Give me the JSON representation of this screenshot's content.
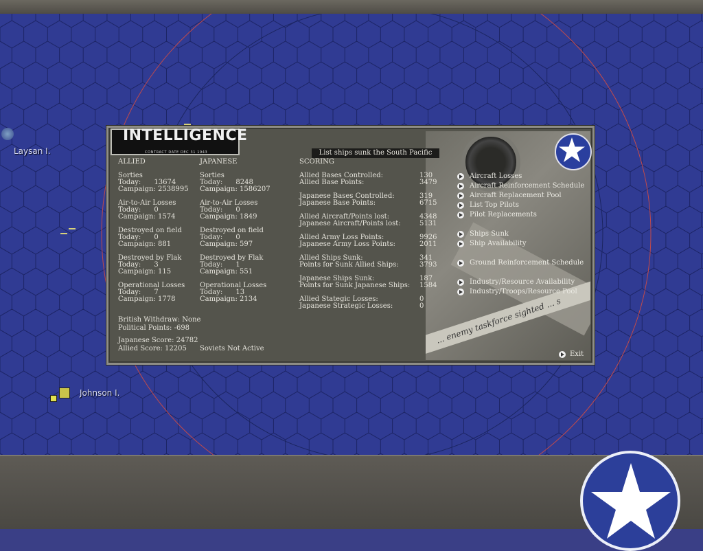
{
  "map": {
    "labels": {
      "laysan": "Laysan I.",
      "johnson": "Johnson I."
    }
  },
  "panel": {
    "title": "INTELLIGENCE",
    "contract_date": "CONTRACT DATE DEC 31 1943",
    "header_box": "List ships sunk the South Pacific",
    "allied": {
      "heading": "ALLIED",
      "sorties": "Sorties",
      "sorties_today": "Today:      13674",
      "sorties_campaign": "Campaign: 2538995",
      "a2a": "Air-to-Air Losses",
      "a2a_today": "Today:      0",
      "a2a_campaign": "Campaign: 1574",
      "dof": "Destroyed on field",
      "dof_today": "Today:      0",
      "dof_campaign": "Campaign: 881",
      "flak": "Destroyed by Flak",
      "flak_today": "Today:      3",
      "flak_campaign": "Campaign: 115",
      "op": "Operational Losses",
      "op_today": "Today:      7",
      "op_campaign": "Campaign: 1778",
      "british": "British Withdraw: None",
      "political": "Political Points: -698",
      "jscore": "Japanese Score: 24782",
      "ascore": "Allied Score: 12205"
    },
    "japanese": {
      "heading": "JAPANESE",
      "sorties": "Sorties",
      "sorties_today": "Today:      8248",
      "sorties_campaign": "Campaign: 1586207",
      "a2a": "Air-to-Air Losses",
      "a2a_today": "Today:      0",
      "a2a_campaign": "Campaign: 1849",
      "dof": "Destroyed on field",
      "dof_today": "Today:      0",
      "dof_campaign": "Campaign: 597",
      "flak": "Destroyed by Flak",
      "flak_today": "Today:      1",
      "flak_campaign": "Campaign: 551",
      "op": "Operational Losses",
      "op_today": "Today:      13",
      "op_campaign": "Campaign: 2134",
      "soviets": "Soviets Not Active"
    },
    "scoring": {
      "heading": "SCORING",
      "rows": [
        {
          "label": "Allied Bases Controlled:",
          "value": "130"
        },
        {
          "label": "Allied Base Points:",
          "value": "3479"
        },
        {
          "label": "Japanese Bases Controlled:",
          "value": "319"
        },
        {
          "label": "Japanese Base Points:",
          "value": "6715"
        },
        {
          "label": "Allied Aircraft/Points lost:",
          "value": "4348"
        },
        {
          "label": "Japanese Aircraft/Points lost:",
          "value": "5131"
        },
        {
          "label": "Allied Army Loss Points:",
          "value": "9926"
        },
        {
          "label": "Japanese Army Loss Points:",
          "value": "2011"
        },
        {
          "label": "Allied Ships Sunk:",
          "value": "341"
        },
        {
          "label": "Points for Sunk Allied Ships:",
          "value": "3793"
        },
        {
          "label": "Japanese Ships Sunk:",
          "value": "187"
        },
        {
          "label": "Points for Sunk Japanese Ships:",
          "value": "1584"
        },
        {
          "label": "Allied Stategic Losses:",
          "value": "0"
        },
        {
          "label": "Japanese Strategic Losses:",
          "value": "0"
        }
      ]
    },
    "links": [
      "Aircraft Losses",
      "Aircraft Reinforcement Schedule",
      "Aircraft Replacement Pool",
      "List Top Pilots",
      "Pilot Replacements",
      "Ships Sunk",
      "Ship Availability",
      "Ground Reinforcement Schedule",
      "Industry/Resource Availability",
      "Industry/Troops/Resource Pool"
    ],
    "exit": "Exit",
    "photo_paper_text": "... enemy taskforce sighted ... s"
  },
  "colors": {
    "map_blue": "#303b93",
    "panel_bg": "#54544c",
    "roundel_blue": "#2c3f9a"
  }
}
